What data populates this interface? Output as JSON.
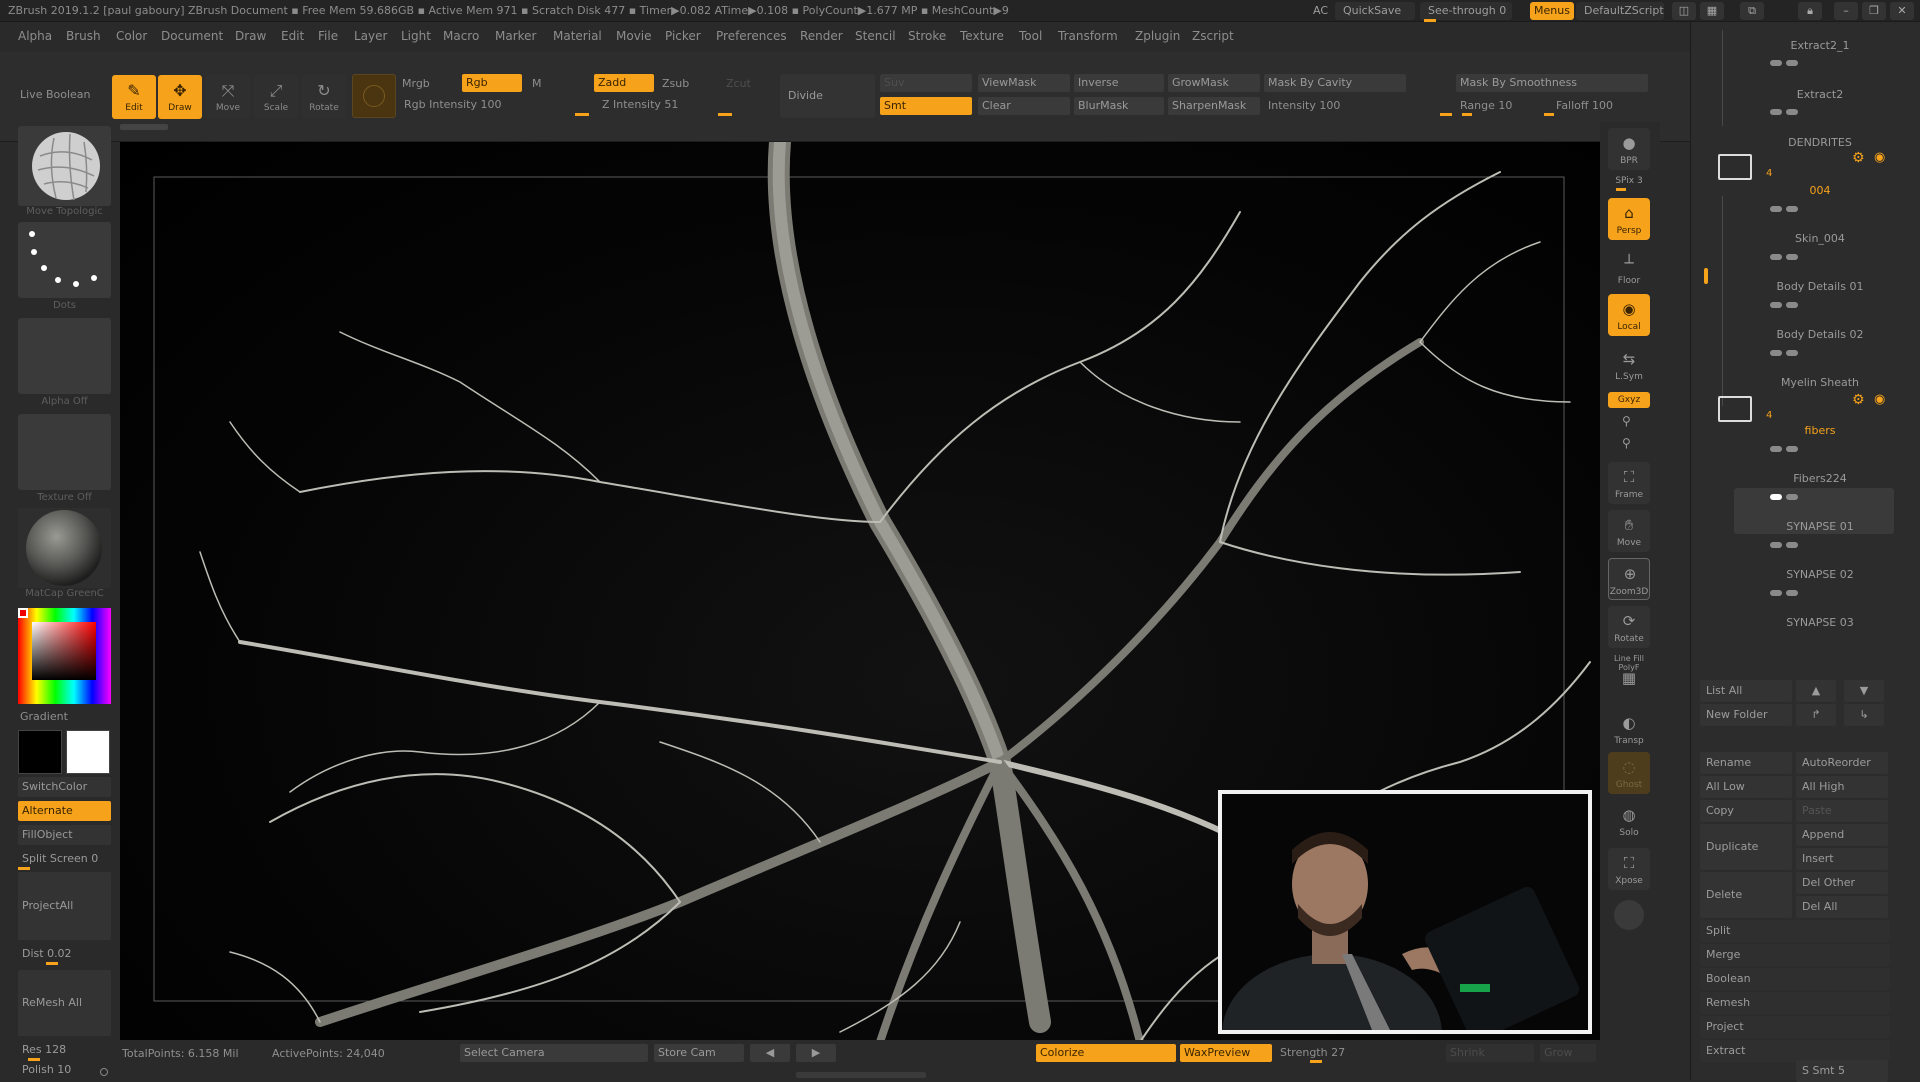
{
  "titlebar": {
    "title": "ZBrush 2019.1.2 [paul gaboury]  ZBrush Document   ▪ Free Mem 59.686GB ▪ Active Mem 971 ▪ Scratch Disk 477 ▪  Timer▶0.082 ATime▶0.108 ▪ PolyCount▶1.677 MP ▪ MeshCount▶9",
    "ac": "AC",
    "quicksave": "QuickSave",
    "see_through": "See-through  0",
    "menus": "Menus",
    "default_zscript": "DefaultZScript"
  },
  "menubar": [
    "Alpha",
    "Brush",
    "Color",
    "Document",
    "Draw",
    "Edit",
    "File",
    "Layer",
    "Light",
    "Macro",
    "Marker",
    "Material",
    "Movie",
    "Picker",
    "Preferences",
    "Render",
    "Stencil",
    "Stroke",
    "Texture",
    "Tool",
    "Transform",
    "Zplugin",
    "Zscript"
  ],
  "shelf": {
    "live_boolean": "Live Boolean",
    "tools": [
      "Edit",
      "Draw",
      "Move",
      "Scale",
      "Rotate"
    ],
    "mrgb": "Mrgb",
    "rgb": "Rgb",
    "m": "M",
    "rgb_intensity": "Rgb Intensity 100",
    "zadd": "Zadd",
    "zsub": "Zsub",
    "zcut": "Zcut",
    "z_intensity": "Z Intensity 51",
    "divide": "Divide",
    "suv": "Suv",
    "smt": "Smt",
    "viewmask": "ViewMask",
    "clear": "Clear",
    "inverse": "Inverse",
    "blurmask": "BlurMask",
    "growmask": "GrowMask",
    "sharpenmask": "SharpenMask",
    "mask_by_cavity": "Mask By Cavity",
    "intensity": "Intensity 100",
    "mask_by_smoothness": "Mask By Smoothness",
    "range": "Range 10",
    "falloff": "Falloff 100"
  },
  "leftpanel": {
    "brush_caption": "Move Topologic",
    "stroke_caption": "Dots",
    "alpha_caption": "Alpha Off",
    "texture_caption": "Texture Off",
    "material_caption": "MatCap GreenC",
    "gradient": "Gradient",
    "switchcolor": "SwitchColor",
    "alternate": "Alternate",
    "fillobject": "FillObject",
    "split_screen": "Split Screen 0",
    "projectall": "ProjectAll",
    "dist": "Dist 0.02",
    "remesh_all": "ReMesh All",
    "res": "Res 128",
    "polish": "Polish 10"
  },
  "righttools": [
    "BPR",
    "SPix 3",
    "Persp",
    "Floor",
    "Local",
    "L.Sym",
    "Gxyz",
    "Frame",
    "Move",
    "Zoom3D",
    "Rotate",
    "Line Fill PolyF",
    "Transp",
    "Ghost",
    "Solo",
    "Xpose"
  ],
  "bottombar": {
    "total_points": "TotalPoints: 6.158 Mil",
    "active_points": "ActivePoints: 24,040",
    "select_camera": "Select Camera",
    "store_cam": "Store Cam",
    "colorize": "Colorize",
    "wax_preview": "WaxPreview",
    "strength": "Strength 27",
    "shrink": "Shrink",
    "grow": "Grow"
  },
  "subtools": {
    "extract_1": "Extract2_1",
    "extract_2": "Extract2",
    "folder_dendrites": "DENDRITES",
    "dendrites_count": "4",
    "item_004": "004",
    "skin_004": "Skin_004",
    "body_details_01": "Body Details 01",
    "body_details_02": "Body Details 02",
    "myelin_sheath": "Myelin Sheath",
    "folder_count_2": "4",
    "fibers": "fibers",
    "fibers224": "Fibers224",
    "synapse_01": "SYNAPSE 01",
    "synapse_02": "SYNAPSE 02",
    "synapse_03": "SYNAPSE 03"
  },
  "subtool_buttons": {
    "list_all": "List All",
    "new_folder": "New Folder",
    "rename": "Rename",
    "autoreorder": "AutoReorder",
    "all_low": "All Low",
    "all_high": "All High",
    "copy": "Copy",
    "paste": "Paste",
    "duplicate": "Duplicate",
    "append": "Append",
    "insert": "Insert",
    "delete": "Delete",
    "del_other": "Del Other",
    "del_all": "Del All",
    "split": "Split",
    "merge": "Merge",
    "boolean": "Boolean",
    "remesh": "Remesh",
    "project": "Project",
    "extract": "Extract",
    "s_smt": "S Smt 5"
  },
  "colors": {
    "accent": "#f6a21b",
    "background": "#2a2a2a",
    "viewport": "#000000"
  }
}
